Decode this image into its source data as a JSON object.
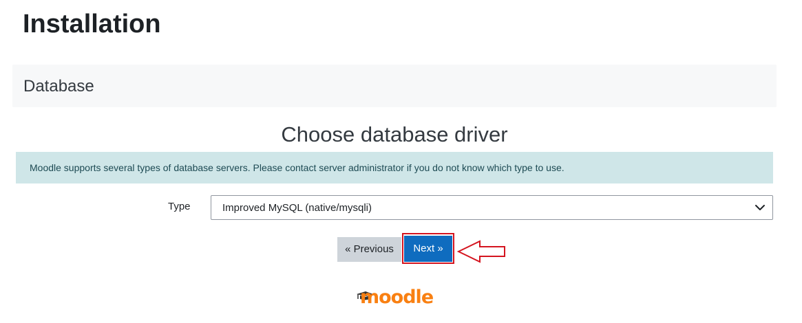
{
  "page": {
    "title": "Installation"
  },
  "section": {
    "title": "Database"
  },
  "main": {
    "heading": "Choose database driver",
    "notice": "Moodle supports several types of database servers. Please contact server administrator if you do not know which type to use.",
    "type_field": {
      "label": "Type",
      "selected_value": "Improved MySQL (native/mysqli)"
    }
  },
  "actions": {
    "previous_label": "« Previous",
    "next_label": "Next »"
  },
  "footer": {
    "logo_text": "moodle"
  },
  "colors": {
    "primary": "#0f6cbf",
    "notice_bg": "#cfe6e8",
    "highlight": "#d4141f",
    "logo": "#f98012"
  },
  "icons": {
    "select_chevron": "chevron-down-icon",
    "annotation_arrow": "arrow-left-icon",
    "logo_cap": "graduation-cap-icon"
  }
}
